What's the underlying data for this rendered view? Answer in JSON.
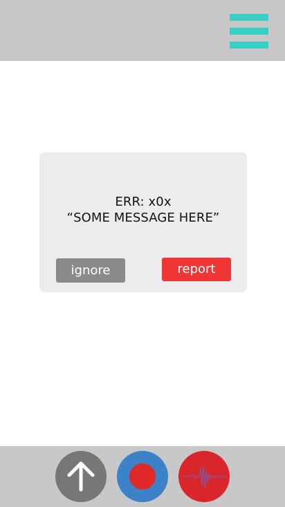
{
  "header": {
    "menu_icon": "hamburger-menu-icon",
    "accent_color": "#39cfc6"
  },
  "dialog": {
    "error_code": "ERR: x0x",
    "error_message": "“SOME MESSAGE HERE”",
    "ignore_label": "ignore",
    "report_label": "report",
    "ignore_color": "#8a8a8a",
    "report_color": "#f03535"
  },
  "bottom_bar": {
    "buttons": [
      {
        "icon": "upload-arrow-icon",
        "color": "#777777"
      },
      {
        "icon": "record-icon",
        "color": "#3b82c8"
      },
      {
        "icon": "pulse-waveform-icon",
        "color": "#d8262b"
      }
    ]
  }
}
